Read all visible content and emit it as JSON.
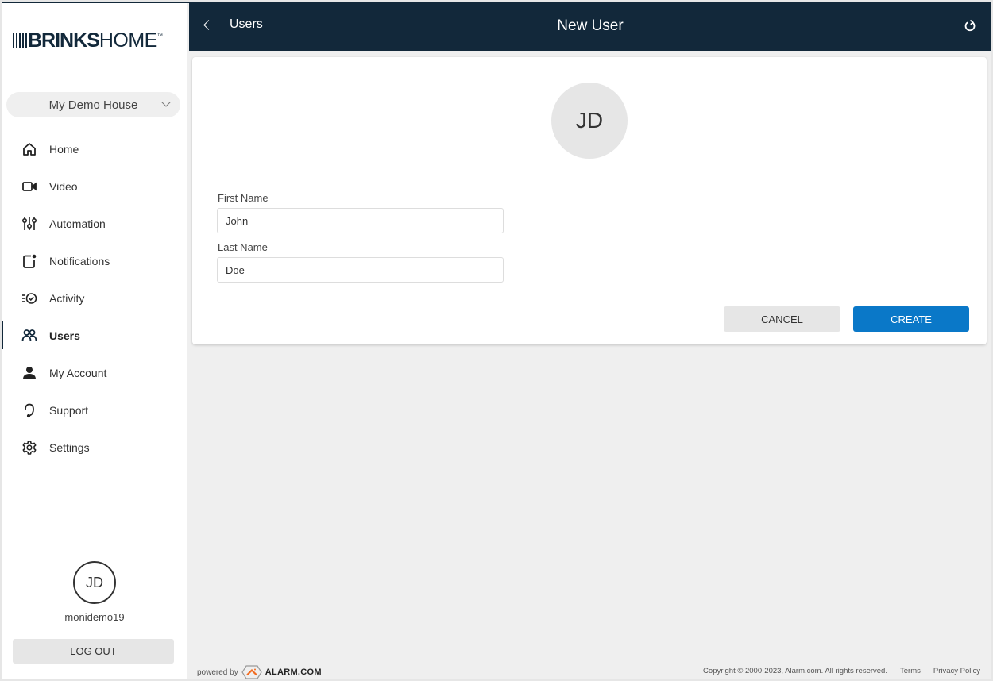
{
  "brand": {
    "name_bold": "BRINKS",
    "name_light": "HOME",
    "trademark": "™"
  },
  "sidebar": {
    "location_select": "My Demo House",
    "items": [
      {
        "label": "Home",
        "icon": "home-icon",
        "active": false
      },
      {
        "label": "Video",
        "icon": "video-camera-icon",
        "active": false
      },
      {
        "label": "Automation",
        "icon": "sliders-icon",
        "active": false
      },
      {
        "label": "Notifications",
        "icon": "notification-icon",
        "active": false
      },
      {
        "label": "Activity",
        "icon": "activity-icon",
        "active": false
      },
      {
        "label": "Users",
        "icon": "users-icon",
        "active": true
      },
      {
        "label": "My Account",
        "icon": "person-icon",
        "active": false
      },
      {
        "label": "Support",
        "icon": "headset-icon",
        "active": false
      },
      {
        "label": "Settings",
        "icon": "gear-icon",
        "active": false
      }
    ],
    "user": {
      "initials": "JD",
      "username": "monidemo19"
    },
    "logout_label": "LOG OUT"
  },
  "header": {
    "back_label": "Users",
    "title": "New User",
    "refresh_icon": "refresh-icon"
  },
  "form": {
    "avatar_initials": "JD",
    "first_name": {
      "label": "First Name",
      "value": "John"
    },
    "last_name": {
      "label": "Last Name",
      "value": "Doe"
    },
    "cancel_label": "CANCEL",
    "create_label": "CREATE"
  },
  "footer": {
    "powered_by": "powered by",
    "powered_brand": "ALARM.COM",
    "copyright": "Copyright © 2000-2023, Alarm.com. All rights reserved.",
    "terms_label": "Terms",
    "privacy_label": "Privacy Policy"
  },
  "colors": {
    "header_bg": "#12283a",
    "primary_button": "#0a78c8",
    "page_bg": "#efefef"
  }
}
